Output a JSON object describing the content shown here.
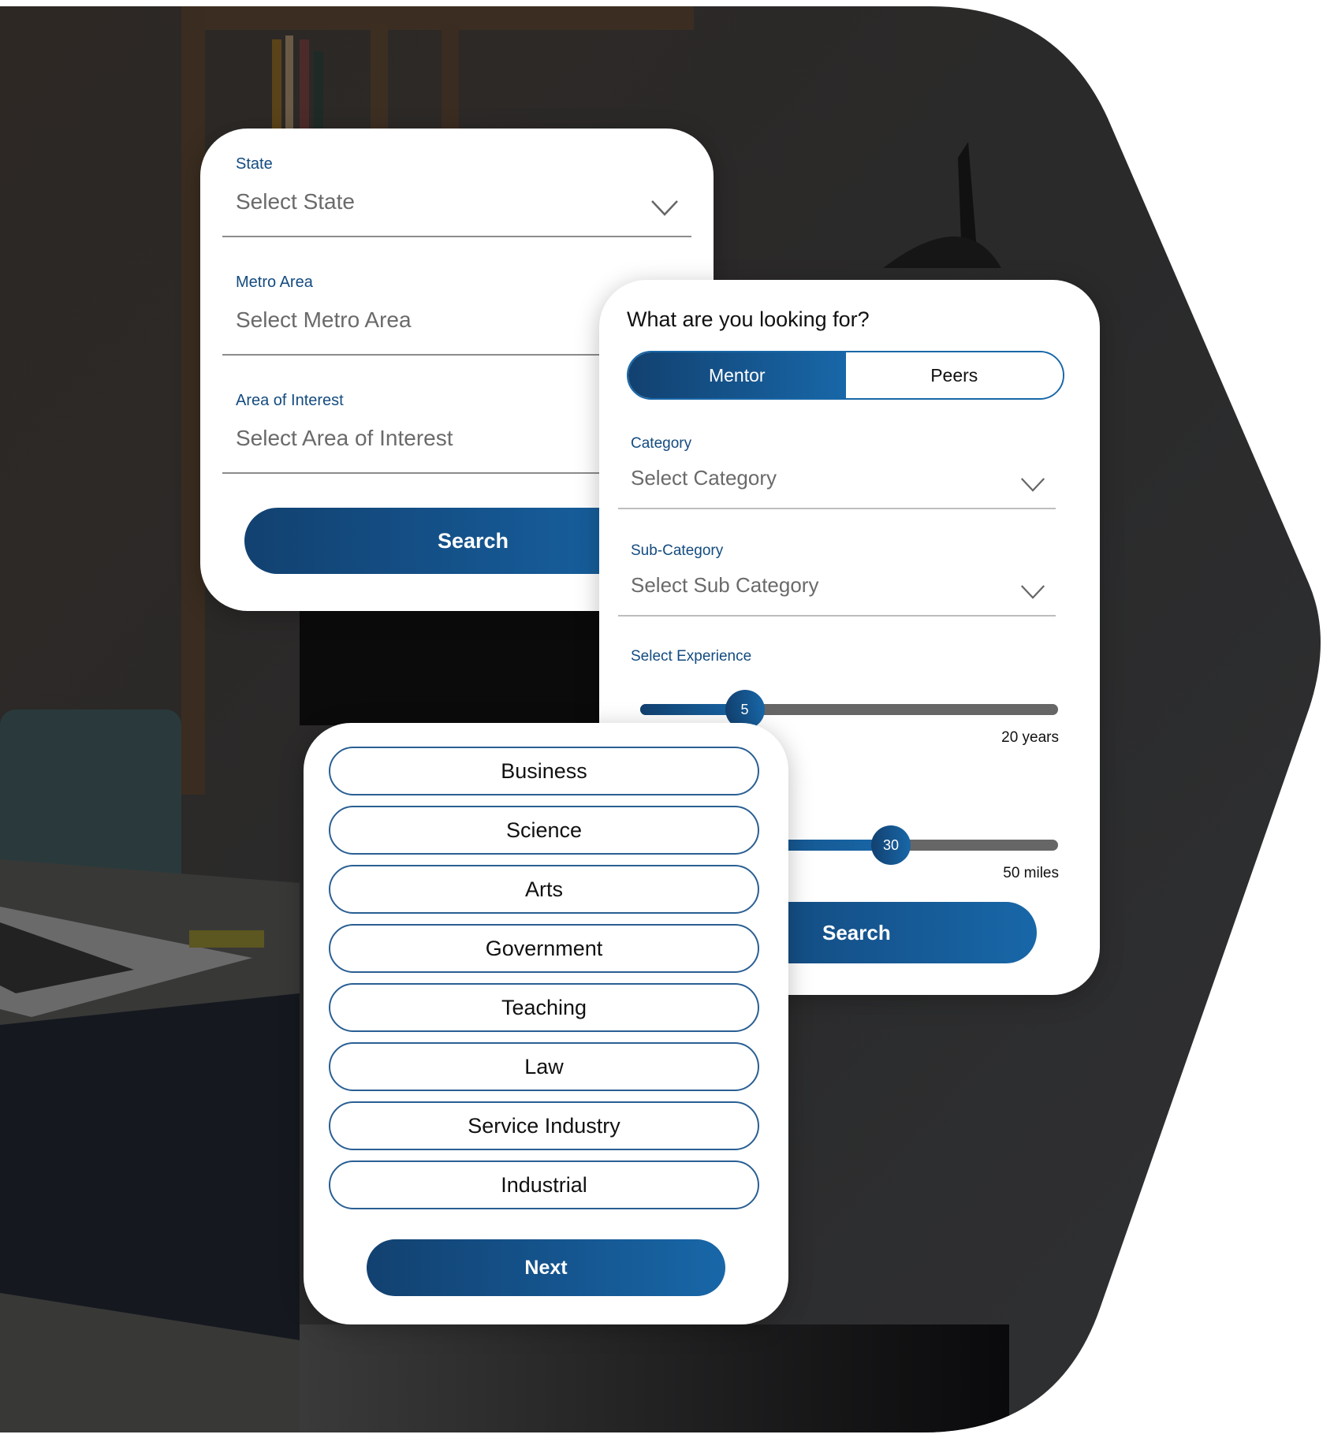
{
  "colors": {
    "brand_dark": "#124170",
    "brand_light": "#1867a8",
    "label": "#134b80",
    "placeholder": "#6a6a6a",
    "track": "#666666"
  },
  "location_form": {
    "fields": [
      {
        "label": "State",
        "placeholder": "Select State",
        "icon": "chevron-down-icon"
      },
      {
        "label": "Metro Area",
        "placeholder": "Select Metro Area"
      },
      {
        "label": "Area of Interest",
        "placeholder": "Select Area of Interest"
      }
    ],
    "search_label": "Search"
  },
  "looking_for_form": {
    "question": "What are you looking for?",
    "toggle": {
      "options": [
        "Mentor",
        "Peers"
      ],
      "selected": "Mentor"
    },
    "fields": [
      {
        "label": "Category",
        "placeholder": "Select Category",
        "icon": "chevron-down-icon"
      },
      {
        "label": "Sub-Category",
        "placeholder": "Select Sub Category",
        "icon": "chevron-down-icon"
      }
    ],
    "experience": {
      "label": "Select Experience",
      "value": "5",
      "max_label": "20 years",
      "value_num": 5,
      "max": 20
    },
    "distance": {
      "value": "30",
      "max_label": "50 miles",
      "value_num": 30,
      "max": 50
    },
    "search_label": "Search"
  },
  "interest_picker": {
    "options": [
      "Business",
      "Science",
      "Arts",
      "Government",
      "Teaching",
      "Law",
      "Service Industry",
      "Industrial"
    ],
    "next_label": "Next"
  }
}
